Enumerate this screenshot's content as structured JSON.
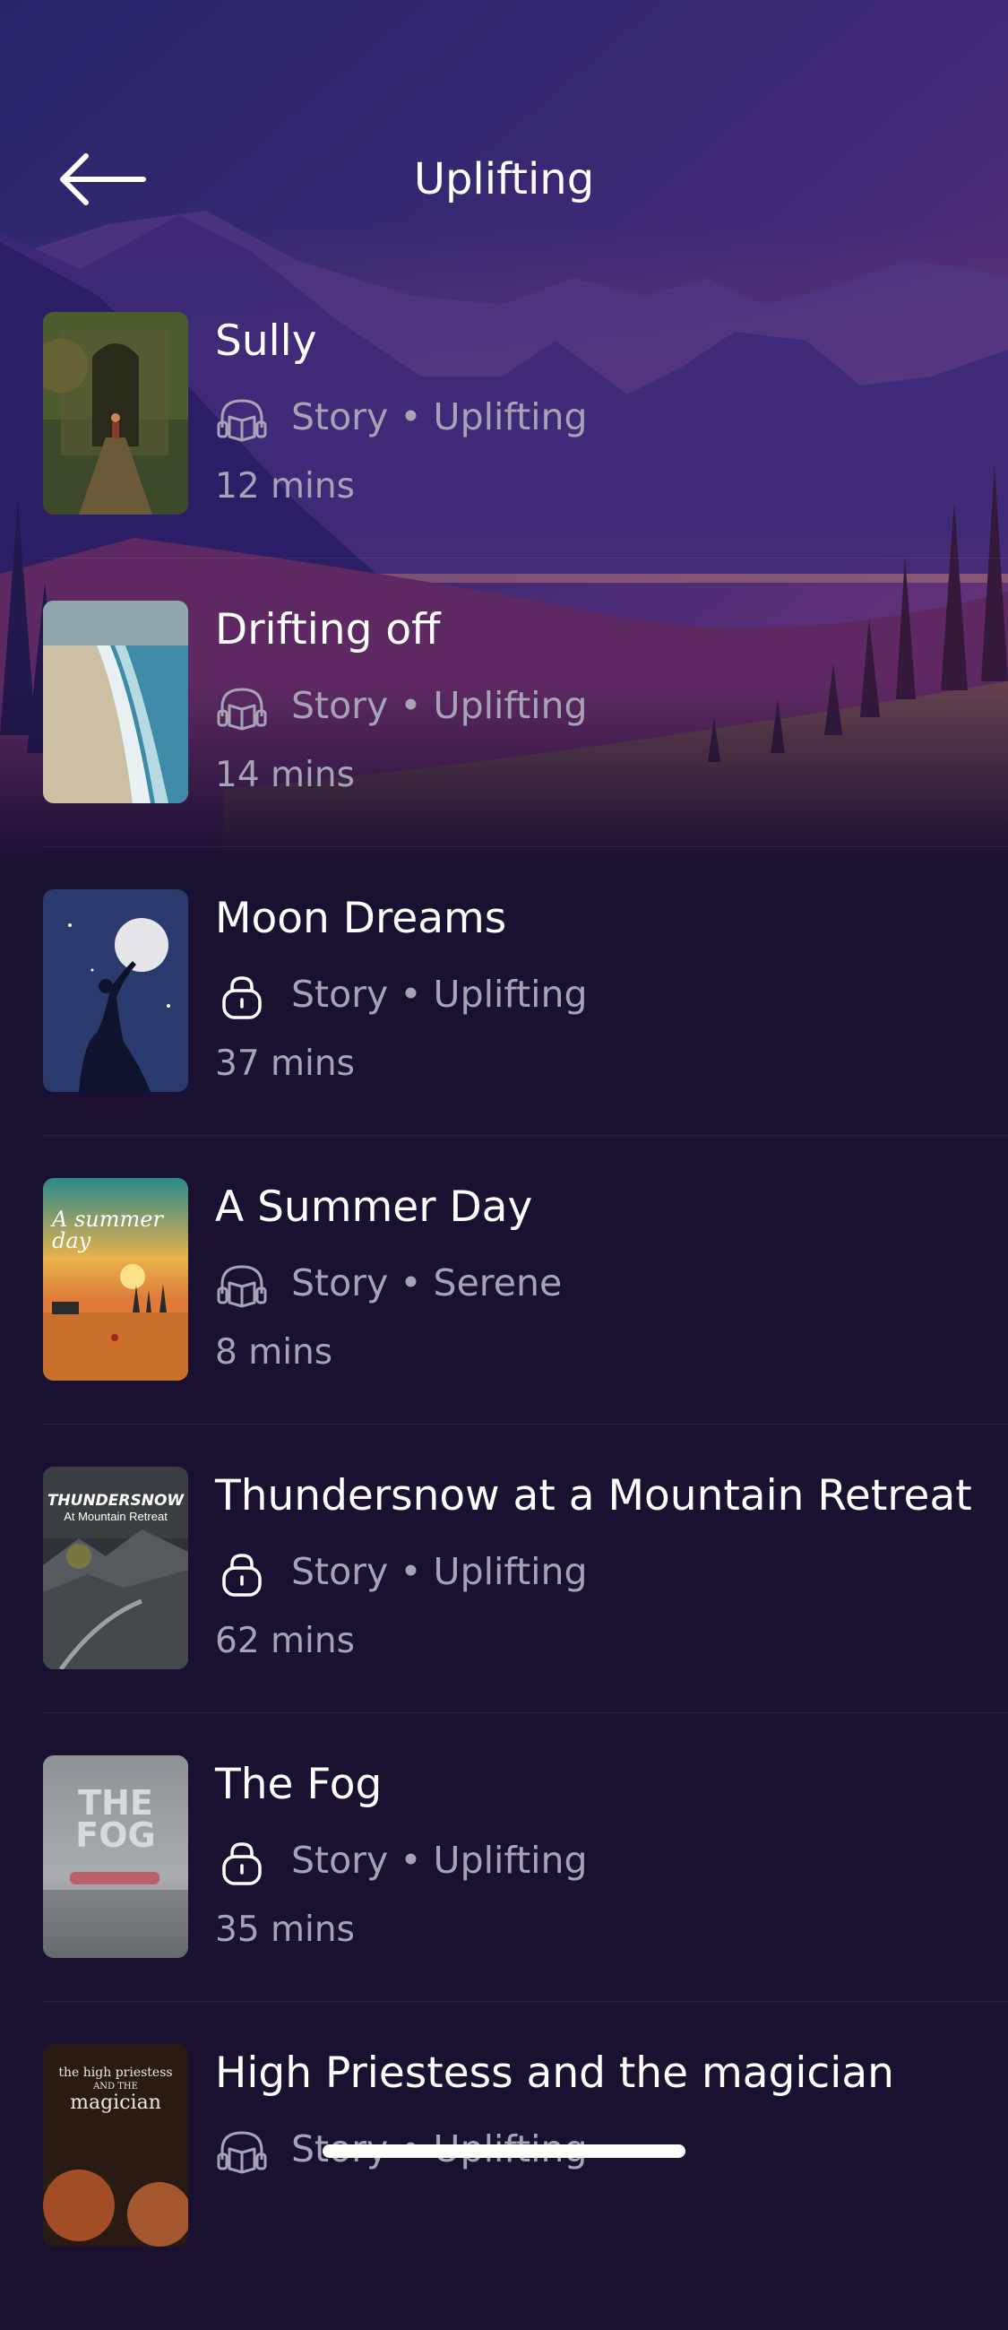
{
  "header": {
    "title": "Uplifting"
  },
  "items": [
    {
      "title": "Sully",
      "meta": "Story • Uplifting",
      "duration": "12 mins",
      "icon": "headphones-book-icon",
      "locked": false
    },
    {
      "title": "Drifting off",
      "meta": "Story • Uplifting",
      "duration": "14 mins",
      "icon": "headphones-book-icon",
      "locked": false
    },
    {
      "title": "Moon Dreams",
      "meta": "Story • Uplifting",
      "duration": "37 mins",
      "icon": "lock-icon",
      "locked": true
    },
    {
      "title": "A Summer Day",
      "meta": "Story • Serene",
      "duration": "8 mins",
      "icon": "headphones-book-icon",
      "locked": false
    },
    {
      "title": "Thundersnow at a Mountain Retreat",
      "meta": "Story • Uplifting",
      "duration": "62 mins",
      "icon": "lock-icon",
      "locked": true
    },
    {
      "title": "The Fog",
      "meta": "Story • Uplifting",
      "duration": "35 mins",
      "icon": "lock-icon",
      "locked": true
    },
    {
      "title": "High Priestess and the magician",
      "meta": "Story • Uplifting",
      "duration": "",
      "icon": "headphones-book-icon",
      "locked": false
    }
  ],
  "thumbnails": {
    "summer": "A summer day",
    "thundersnow_title": "THUNDERSNOW",
    "thundersnow_sub": "At Mountain Retreat",
    "fog_line1": "THE",
    "fog_line2": "FOG",
    "priestess_line1": "the high priestess",
    "priestess_line2": "AND THE",
    "priestess_line3": "magician"
  },
  "colors": {
    "background": "#1a1131",
    "text_primary": "#ffffff",
    "text_secondary": "#a7a3b6",
    "accent_purple": "#7b3fa0"
  }
}
